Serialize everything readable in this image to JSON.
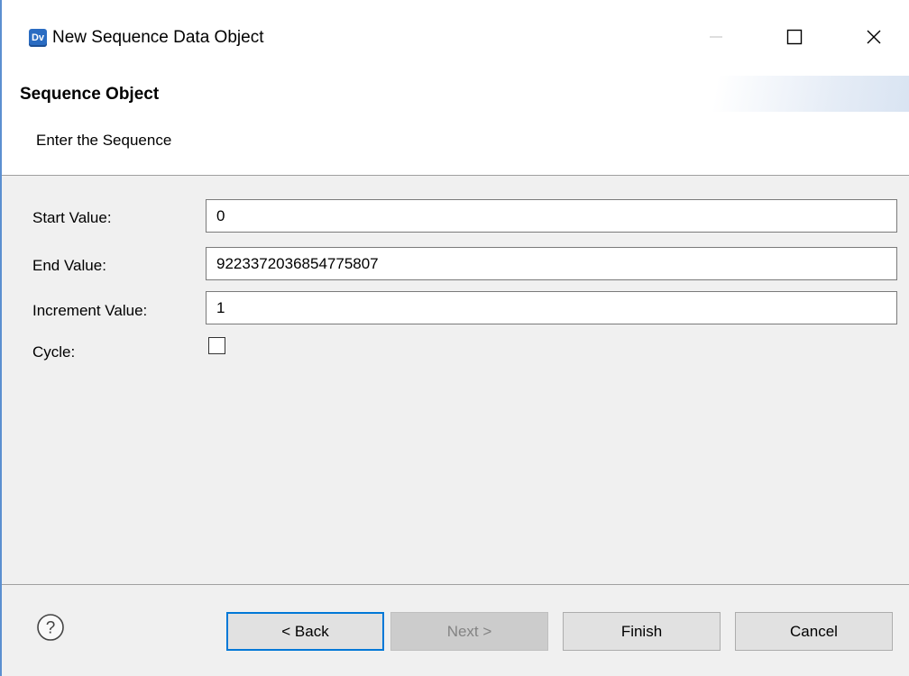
{
  "window": {
    "icon_text": "Dv",
    "title": "New Sequence Data Object"
  },
  "header": {
    "title": "Sequence Object",
    "description": "Enter the Sequence"
  },
  "form": {
    "start_label": "Start Value:",
    "start_value": "0",
    "end_label": "End Value:",
    "end_value": "9223372036854775807",
    "increment_label": "Increment Value:",
    "increment_value": "1",
    "cycle_label": "Cycle:",
    "cycle_checked": false
  },
  "footer": {
    "back_label": "< Back",
    "next_label": "Next >",
    "finish_label": "Finish",
    "cancel_label": "Cancel"
  },
  "colors": {
    "accent": "#0078d7",
    "window_border": "#5b8fd0",
    "dialog_bg": "#f0f0f0",
    "button_bg": "#e1e1e1",
    "disabled_text": "#838383"
  },
  "icons": [
    "app-icon",
    "minimize-icon",
    "maximize-icon",
    "close-icon",
    "help-icon"
  ]
}
